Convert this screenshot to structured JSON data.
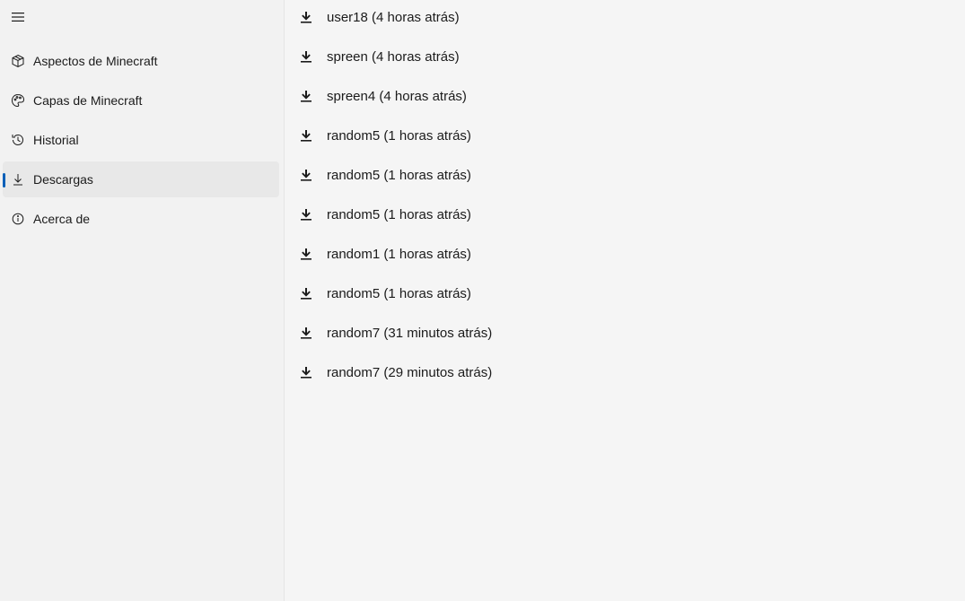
{
  "sidebar": {
    "menu_icon": "hamburger-menu-icon",
    "items": [
      {
        "label": "Aspectos de Minecraft",
        "icon": "skin-cube-icon",
        "selected": false
      },
      {
        "label": "Capas de Minecraft",
        "icon": "palette-icon",
        "selected": false
      },
      {
        "label": "Historial",
        "icon": "history-icon",
        "selected": false
      },
      {
        "label": "Descargas",
        "icon": "download-icon",
        "selected": true
      },
      {
        "label": "Acerca de",
        "icon": "info-icon",
        "selected": false
      }
    ]
  },
  "downloads": {
    "items": [
      {
        "label": "user18 (4 horas atrás)"
      },
      {
        "label": "spreen (4 horas atrás)"
      },
      {
        "label": "spreen4 (4 horas atrás)"
      },
      {
        "label": "random5 (1 horas atrás)"
      },
      {
        "label": "random5 (1 horas atrás)"
      },
      {
        "label": "random5 (1 horas atrás)"
      },
      {
        "label": "random1 (1 horas atrás)"
      },
      {
        "label": "random5 (1 horas atrás)"
      },
      {
        "label": "random7 (31 minutos atrás)"
      },
      {
        "label": "random7 (29 minutos atrás)"
      }
    ]
  },
  "colors": {
    "accent": "#005fb8",
    "sidebar_bg": "#f2f2f2",
    "content_bg": "#f5f5f5",
    "selected_bg": "#e8e8e8"
  }
}
